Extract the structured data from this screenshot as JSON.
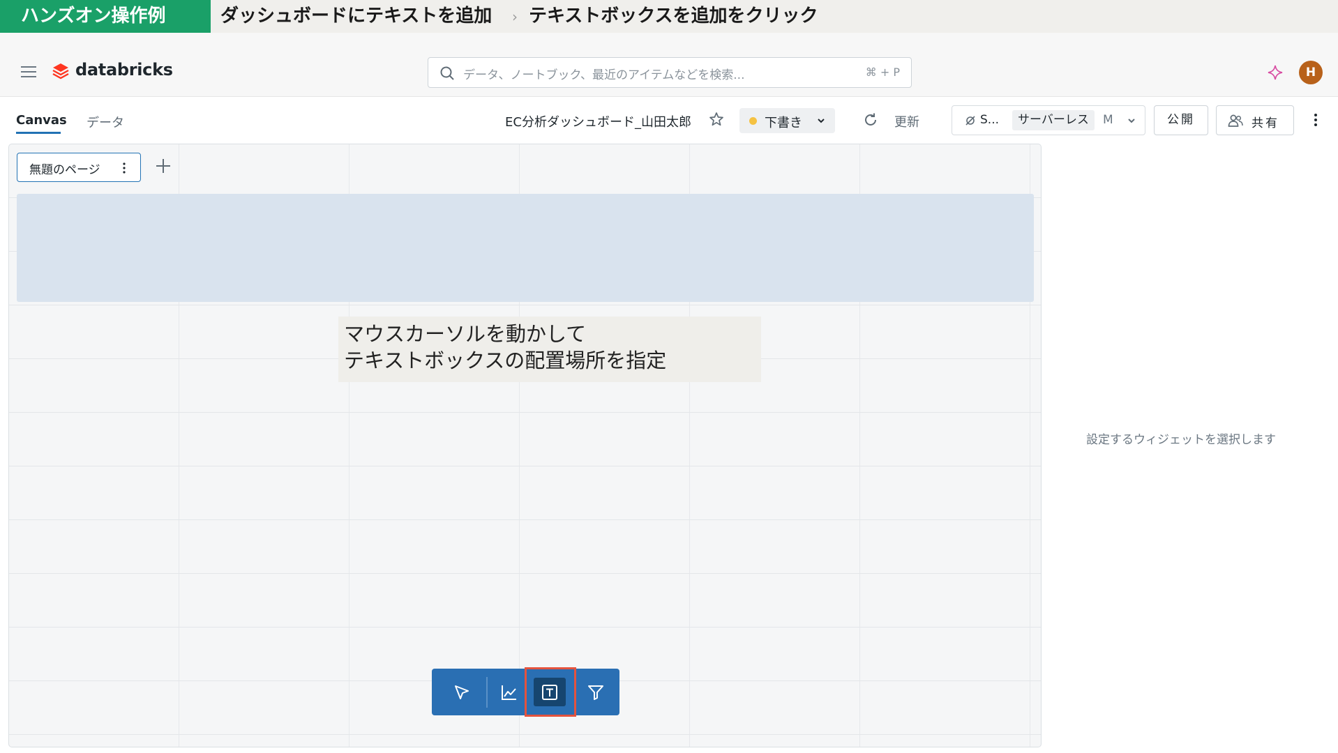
{
  "banner": {
    "tag": "ハンズオン操作例",
    "step1": "ダッシュボードにテキストを追加",
    "separator": "›",
    "step2": "テキストボックスを追加をクリック"
  },
  "topbar": {
    "brand": "databricks",
    "search_placeholder": "データ、ノートブック、最近のアイテムなどを検索...",
    "search_shortcut": "⌘ + P",
    "avatar_initial": "H"
  },
  "toolbar": {
    "tabs": [
      {
        "label": "Canvas",
        "active": true
      },
      {
        "label": "データ",
        "active": false
      }
    ],
    "dashboard_title": "EC分析ダッシュボード_山田太郎",
    "status_label": "下書き",
    "refresh_label": "更新",
    "warehouse_short": "S...",
    "warehouse_type": "サーバーレス",
    "warehouse_size": "M",
    "publish_label": "公開",
    "share_label": "共有"
  },
  "canvas": {
    "page_tab_label": "無題のページ",
    "callout_line1": "マウスカーソルを動かして",
    "callout_line2": "テキストボックスの配置場所を指定",
    "widget_tools": [
      "select-cursor-icon",
      "add-visualization-icon",
      "add-text-box-icon",
      "add-filter-icon"
    ],
    "highlighted_tool": "add-text-box-icon"
  },
  "side_panel": {
    "hint": "設定するウィジェットを選択します"
  },
  "colors": {
    "banner_green": "#1aa068",
    "accent_blue": "#2272b4",
    "widget_bar": "#2a6fb3",
    "highlight_red": "#e4533e",
    "draft_yellow": "#f5c242",
    "avatar_orange": "#b8611a"
  }
}
